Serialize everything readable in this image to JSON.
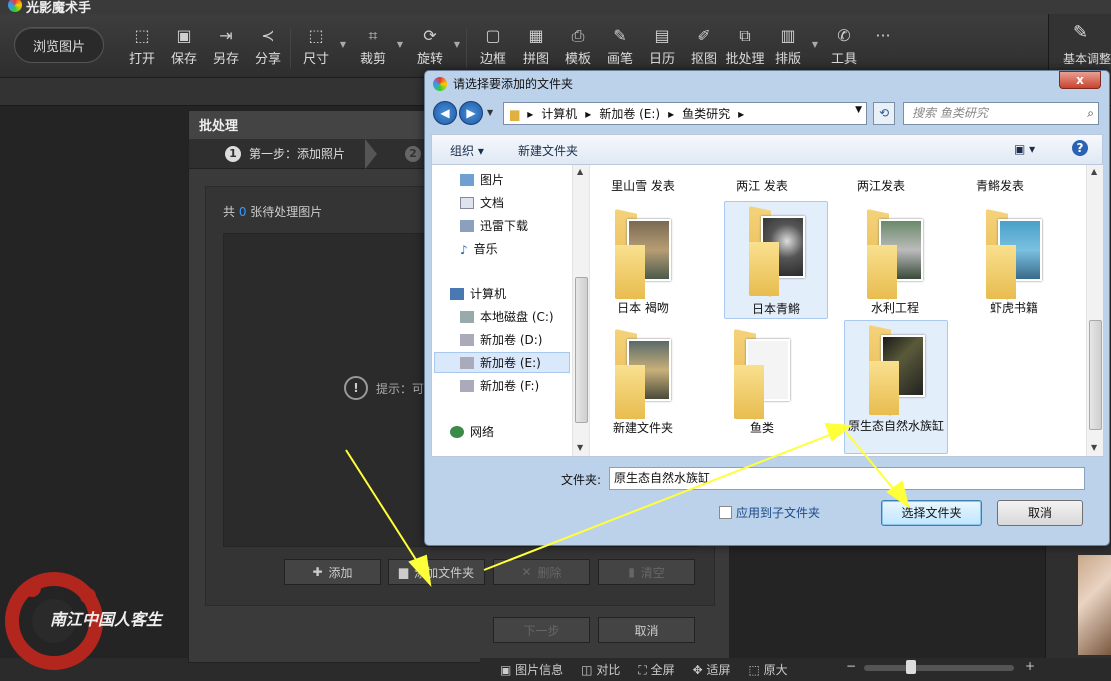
{
  "app": {
    "title": "光影魔术手"
  },
  "toolbar": {
    "browse_label": "浏览图片",
    "items": [
      {
        "label": "打开",
        "icon": "open-icon"
      },
      {
        "label": "保存",
        "icon": "save-icon"
      },
      {
        "label": "另存",
        "icon": "save-as-icon"
      },
      {
        "label": "分享",
        "icon": "share-icon"
      },
      {
        "label": "尺寸",
        "icon": "resize-icon"
      },
      {
        "label": "裁剪",
        "icon": "crop-icon"
      },
      {
        "label": "旋转",
        "icon": "rotate-icon"
      },
      {
        "label": "边框",
        "icon": "frame-icon"
      },
      {
        "label": "拼图",
        "icon": "collage-icon"
      },
      {
        "label": "模板",
        "icon": "template-icon"
      },
      {
        "label": "画笔",
        "icon": "brush-icon"
      },
      {
        "label": "日历",
        "icon": "calendar-icon"
      },
      {
        "label": "抠图",
        "icon": "cutout-icon"
      },
      {
        "label": "批处理",
        "icon": "batch-icon"
      },
      {
        "label": "排版",
        "icon": "layout-icon"
      },
      {
        "label": "工具",
        "icon": "tools-icon"
      }
    ],
    "more": "···",
    "right_panel_label": "基本调整"
  },
  "batch": {
    "title": "批处理",
    "step1": "第一步：添加照片",
    "step1_num": "1",
    "step2_num": "2",
    "count_prefix": "共 ",
    "count_value": "0",
    "count_suffix": " 张待处理图片",
    "tip": "提示：可",
    "buttons": {
      "add": "添加",
      "add_folder": "添加文件夹",
      "delete": "删除",
      "clear": "清空",
      "next": "下一步",
      "cancel": "取消"
    }
  },
  "bottombar": {
    "info": "图片信息",
    "compare": "对比",
    "fullscreen": "全屏",
    "fit": "适屏",
    "original": "原大",
    "zoom_minus": "−",
    "zoom_plus": "+",
    "zoom_level": 0.3
  },
  "watermark": {
    "text": "南江中国人客生"
  },
  "filedialog": {
    "title": "请选择要添加的文件夹",
    "close": "x",
    "address": [
      "计算机",
      "新加卷 (E:)",
      "鱼类研究"
    ],
    "search_placeholder": "搜索 鱼类研究",
    "organize": "组织",
    "new_folder": "新建文件夹",
    "tree": [
      {
        "label": "图片",
        "icon": "pictures-icon"
      },
      {
        "label": "文档",
        "icon": "documents-icon"
      },
      {
        "label": "迅雷下载",
        "icon": "download-icon"
      },
      {
        "label": "音乐",
        "icon": "music-icon"
      },
      {
        "label": "计算机",
        "icon": "computer-icon"
      },
      {
        "label": "本地磁盘 (C:)",
        "icon": "drive-icon"
      },
      {
        "label": "新加卷 (D:)",
        "icon": "drive-icon"
      },
      {
        "label": "新加卷 (E:)",
        "icon": "drive-icon"
      },
      {
        "label": "新加卷 (F:)",
        "icon": "drive-icon"
      },
      {
        "label": "网络",
        "icon": "network-icon"
      }
    ],
    "folders": [
      {
        "name": "里山雪 发表"
      },
      {
        "name": "两江 发表"
      },
      {
        "name": "两江发表"
      },
      {
        "name": "青鳉发表"
      },
      {
        "name": "日本 褐吻"
      },
      {
        "name": "日本青鳉"
      },
      {
        "name": "水利工程"
      },
      {
        "name": "虾虎书籍"
      },
      {
        "name": "新建文件夹"
      },
      {
        "name": "鱼类"
      },
      {
        "name": "原生态自然水族缸"
      }
    ],
    "filename_label": "文件夹:",
    "filename_value": "原生态自然水族缸",
    "subfolder_checkbox": "应用到子文件夹",
    "select_button": "选择文件夹",
    "cancel_button": "取消"
  }
}
